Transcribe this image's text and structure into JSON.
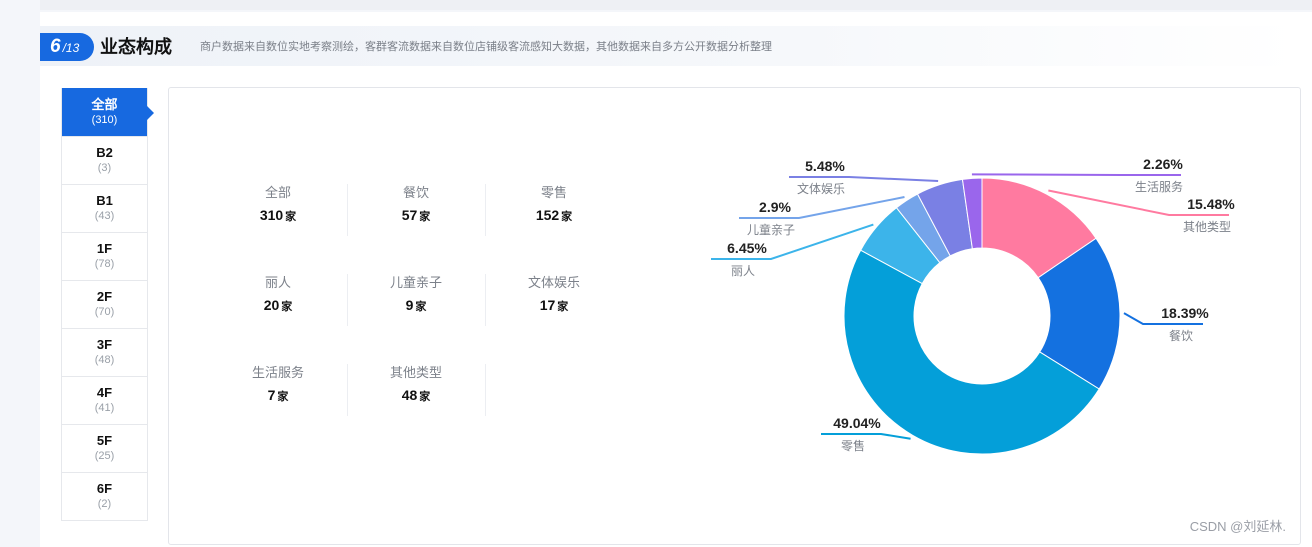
{
  "section": {
    "index": "6",
    "total": "/13",
    "title": "业态构成",
    "description": "商户数据来自数位实地考察测绘，客群客流数据来自数位店铺级客流感知大数据，其他数据来自多方公开数据分析整理"
  },
  "floors": [
    {
      "label": "全部",
      "count": "(310)",
      "active": true
    },
    {
      "label": "B2",
      "count": "(3)"
    },
    {
      "label": "B1",
      "count": "(43)"
    },
    {
      "label": "1F",
      "count": "(78)"
    },
    {
      "label": "2F",
      "count": "(70)"
    },
    {
      "label": "3F",
      "count": "(48)"
    },
    {
      "label": "4F",
      "count": "(41)"
    },
    {
      "label": "5F",
      "count": "(25)"
    },
    {
      "label": "6F",
      "count": "(2)"
    }
  ],
  "stats": [
    {
      "label": "全部",
      "value": "310",
      "unit": "家"
    },
    {
      "label": "餐饮",
      "value": "57",
      "unit": "家"
    },
    {
      "label": "零售",
      "value": "152",
      "unit": "家"
    },
    {
      "label": "丽人",
      "value": "20",
      "unit": "家"
    },
    {
      "label": "儿童亲子",
      "value": "9",
      "unit": "家"
    },
    {
      "label": "文体娱乐",
      "value": "17",
      "unit": "家"
    },
    {
      "label": "生活服务",
      "value": "7",
      "unit": "家"
    },
    {
      "label": "其他类型",
      "value": "48",
      "unit": "家"
    }
  ],
  "chart_data": {
    "type": "pie",
    "donut": true,
    "slices": [
      {
        "name": "其他类型",
        "value": 15.48,
        "label": "15.48%",
        "color": "#ff7aa0"
      },
      {
        "name": "餐饮",
        "value": 18.39,
        "label": "18.39%",
        "color": "#1471e0"
      },
      {
        "name": "零售",
        "value": 49.04,
        "label": "49.04%",
        "color": "#049fd9"
      },
      {
        "name": "丽人",
        "value": 6.45,
        "label": "6.45%",
        "color": "#3cb4ea"
      },
      {
        "name": "儿童亲子",
        "value": 2.9,
        "label": "2.9%",
        "color": "#74a4ea"
      },
      {
        "name": "文体娱乐",
        "value": 5.48,
        "label": "5.48%",
        "color": "#7a80e4"
      },
      {
        "name": "生活服务",
        "value": 2.26,
        "label": "2.26%",
        "color": "#9a66ec"
      }
    ]
  },
  "watermark": "CSDN @刘延林."
}
